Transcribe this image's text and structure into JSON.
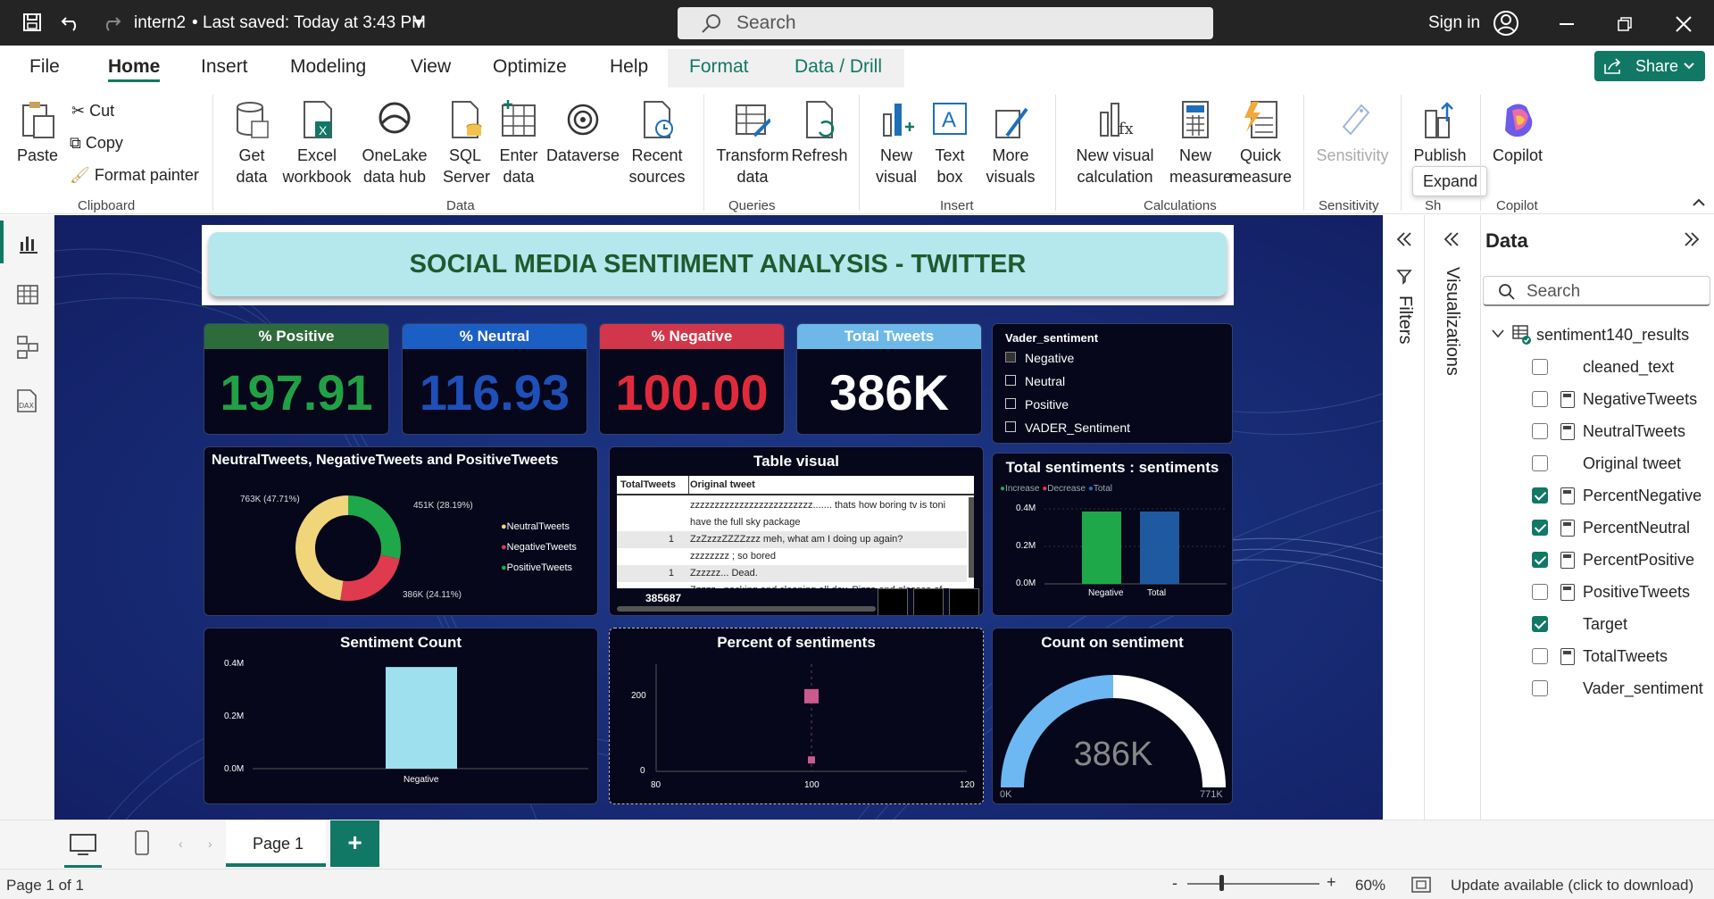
{
  "titlebar": {
    "file_name": "intern2",
    "save_status": "Last saved: Today at 3:43 PM",
    "search_placeholder": "Search",
    "sign_in": "Sign in"
  },
  "ribbon_tabs": [
    "File",
    "Home",
    "Insert",
    "Modeling",
    "View",
    "Optimize",
    "Help",
    "Format",
    "Data / Drill"
  ],
  "share_label": "Share",
  "ribbon": {
    "clipboard": {
      "paste": "Paste",
      "cut": "Cut",
      "copy": "Copy",
      "format_painter": "Format painter",
      "group": "Clipboard"
    },
    "data": {
      "get_data": "Get data",
      "excel": "Excel workbook",
      "onelake": "OneLake data hub",
      "sql": "SQL Server",
      "enter": "Enter data",
      "dataverse": "Dataverse",
      "recent": "Recent sources",
      "group": "Data"
    },
    "queries": {
      "transform": "Transform data",
      "refresh": "Refresh",
      "group": "Queries"
    },
    "insert": {
      "new_visual": "New visual",
      "text_box": "Text box",
      "more_visuals": "More visuals",
      "group": "Insert"
    },
    "calculations": {
      "new_visual_calc": "New visual calculation",
      "new_measure": "New measure",
      "quick_measure": "Quick measure",
      "group": "Calculations"
    },
    "sensitivity": {
      "label": "Sensitivity",
      "group": "Sensitivity"
    },
    "share": {
      "publish": "Publish",
      "group": "Sh"
    },
    "copilot": {
      "label": "Copilot",
      "group": "Copilot"
    },
    "tooltip_expand": "Expand"
  },
  "report": {
    "title": "SOCIAL MEDIA SENTIMENT ANALYSIS - TWITTER",
    "kpis": [
      {
        "label": "% Positive",
        "value": "197.91",
        "head_color": "#2e6b3a",
        "value_color": "#22a045"
      },
      {
        "label": "% Neutral",
        "value": "116.93",
        "head_color": "#1c5fc4",
        "value_color": "#1f4fb8"
      },
      {
        "label": "% Negative",
        "value": "100.00",
        "head_color": "#d2364a",
        "value_color": "#e02a3c"
      },
      {
        "label": "Total Tweets",
        "value": "386K",
        "head_color": "#6db8e8",
        "value_color": "#ffffff"
      }
    ],
    "slicer": {
      "title": "Vader_sentiment",
      "items": [
        "Negative",
        "Neutral",
        "Positive",
        "VADER_Sentiment"
      ]
    },
    "donut": {
      "title": "NeutralTweets, NegativeTweets and PositiveTweets",
      "labels": [
        "763K (47.71%)",
        "451K (28.19%)",
        "386K (24.11%)"
      ],
      "legend": [
        "NeutralTweets",
        "NegativeTweets",
        "PositiveTweets"
      ],
      "colors": [
        "#f0d57a",
        "#e03a4e",
        "#1fa84a"
      ]
    },
    "table": {
      "title": "Table visual",
      "headers": [
        "TotalTweets",
        "Original tweet"
      ],
      "rows": [
        {
          "count": "",
          "text": "zzzzzzzzzzzzzzzzzzzzzzzzz....... thats how boring tv is toni"
        },
        {
          "count": "",
          "text": "have the full sky package"
        },
        {
          "count": "1",
          "text": "ZzZzzzZZZZzzz meh, what am I doing up again?"
        },
        {
          "count": "",
          "text": "zzzzzzzz ; so bored"
        },
        {
          "count": "1",
          "text": "Zzzzzz... Dead."
        },
        {
          "count": "",
          "text": "Zzzzz...packing and cleaning all day. Pizza and glasses of"
        }
      ],
      "total": "385687"
    },
    "waterfall": {
      "title": "Total sentiments : sentiments",
      "legend": [
        "Increase",
        "Decrease",
        "Total"
      ],
      "yticks": [
        "0.4M",
        "0.2M",
        "0.0M"
      ],
      "categories": [
        "Negative",
        "Total"
      ]
    },
    "bar": {
      "title": "Sentiment Count",
      "yticks": [
        "0.4M",
        "0.2M",
        "0.0M"
      ],
      "category": "Negative"
    },
    "scatter": {
      "title": "Percent of sentiments",
      "yticks": [
        "200",
        "0"
      ],
      "xticks": [
        "80",
        "100",
        "120"
      ]
    },
    "gauge": {
      "title": "Count on sentiment",
      "value": "386K",
      "min": "0K",
      "max": "771K"
    }
  },
  "chart_data": [
    {
      "type": "pie",
      "title": "NeutralTweets, NegativeTweets and PositiveTweets",
      "categories": [
        "NeutralTweets",
        "NegativeTweets",
        "PositiveTweets"
      ],
      "values": [
        763,
        386,
        451
      ],
      "value_labels": [
        "763K (47.71%)",
        "386K (24.11%)",
        "451K (28.19%)"
      ]
    },
    {
      "type": "bar",
      "title": "Total sentiments : sentiments",
      "categories": [
        "Negative",
        "Total"
      ],
      "values": [
        0.386,
        0.386
      ],
      "ylim": [
        0,
        0.4
      ]
    },
    {
      "type": "bar",
      "title": "Sentiment Count",
      "categories": [
        "Negative"
      ],
      "values": [
        0.386
      ],
      "ylim": [
        0,
        0.4
      ]
    },
    {
      "type": "scatter",
      "title": "Percent of sentiments",
      "x": [
        100,
        100
      ],
      "y": [
        198,
        30
      ],
      "xlim": [
        80,
        120
      ]
    }
  ],
  "panes": {
    "filters": "Filters",
    "visualizations": "Visualizations",
    "data_title": "Data",
    "data_search": "Search",
    "table_name": "sentiment140_results",
    "fields": [
      {
        "name": "cleaned_text",
        "checked": false,
        "calc": false
      },
      {
        "name": "NegativeTweets",
        "checked": false,
        "calc": true
      },
      {
        "name": "NeutralTweets",
        "checked": false,
        "calc": true
      },
      {
        "name": "Original tweet",
        "checked": false,
        "calc": false
      },
      {
        "name": "PercentNegative",
        "checked": true,
        "calc": true
      },
      {
        "name": "PercentNeutral",
        "checked": true,
        "calc": true
      },
      {
        "name": "PercentPositive",
        "checked": true,
        "calc": true
      },
      {
        "name": "PositiveTweets",
        "checked": false,
        "calc": true
      },
      {
        "name": "Target",
        "checked": true,
        "calc": false
      },
      {
        "name": "TotalTweets",
        "checked": false,
        "calc": true
      },
      {
        "name": "Vader_sentiment",
        "checked": false,
        "calc": false
      }
    ]
  },
  "pages": {
    "current": "Page 1",
    "add": "+"
  },
  "status": {
    "page_info": "Page 1 of 1",
    "zoom": "60%",
    "update": "Update available (click to download)"
  }
}
